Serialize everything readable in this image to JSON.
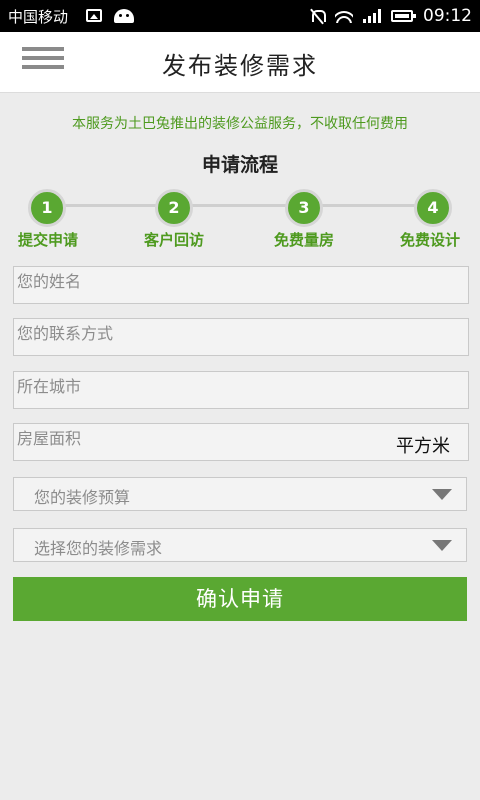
{
  "status_bar": {
    "carrier": "中国移动",
    "time": "09:12"
  },
  "header": {
    "title": "发布装修需求"
  },
  "notice": "本服务为土巴兔推出的装修公益服务，不收取任何费用",
  "flow": {
    "title": "申请流程",
    "steps": [
      {
        "num": "1",
        "label": "提交申请"
      },
      {
        "num": "2",
        "label": "客户回访"
      },
      {
        "num": "3",
        "label": "免费量房"
      },
      {
        "num": "4",
        "label": "免费设计"
      }
    ]
  },
  "form": {
    "name_placeholder": "您的姓名",
    "contact_placeholder": "您的联系方式",
    "city_placeholder": "所在城市",
    "area_placeholder": "房屋面积",
    "area_unit": "平方米",
    "budget_placeholder": "您的装修预算",
    "demand_placeholder": "选择您的装修需求",
    "submit_label": "确认申请"
  },
  "colors": {
    "accent": "#5aa832",
    "notice_text": "#4e9a1f"
  }
}
